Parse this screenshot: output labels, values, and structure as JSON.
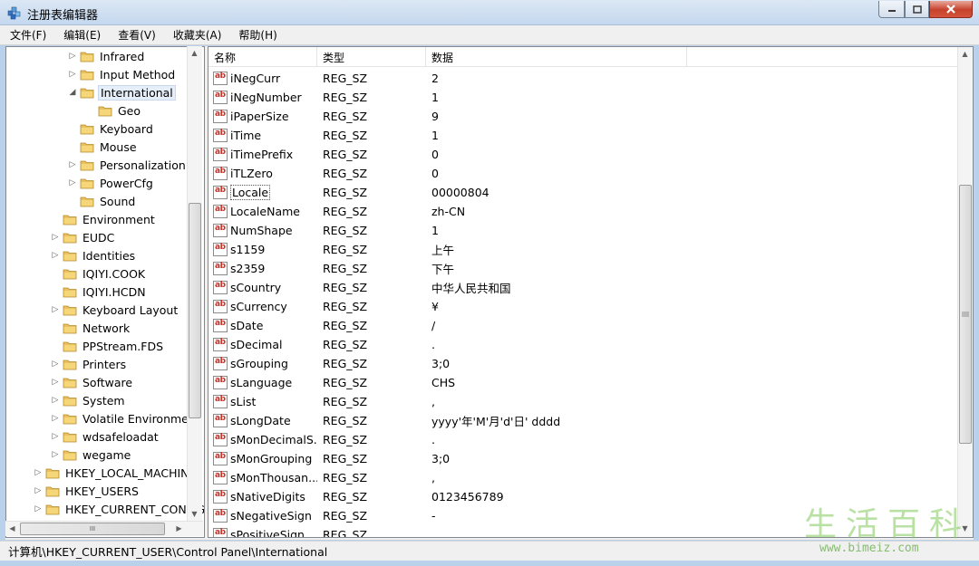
{
  "window": {
    "title": "注册表编辑器",
    "colors": {
      "title_bg": "#c5d8ee",
      "close_btn": "#c6422c",
      "folder": "#e8c160"
    }
  },
  "menu": [
    {
      "label": "文件(F)"
    },
    {
      "label": "编辑(E)"
    },
    {
      "label": "查看(V)"
    },
    {
      "label": "收藏夹(A)"
    },
    {
      "label": "帮助(H)"
    }
  ],
  "tree": [
    {
      "label": "Infrared",
      "expander": "▷"
    },
    {
      "label": "Input Method",
      "expander": "▷"
    },
    {
      "label": "International",
      "expander": "◢",
      "selected": true
    },
    {
      "label": "Geo",
      "expander": ""
    },
    {
      "label": "Keyboard",
      "expander": ""
    },
    {
      "label": "Mouse",
      "expander": ""
    },
    {
      "label": "Personalization",
      "expander": "▷"
    },
    {
      "label": "PowerCfg",
      "expander": "▷"
    },
    {
      "label": "Sound",
      "expander": ""
    },
    {
      "label": "Environment",
      "expander": ""
    },
    {
      "label": "EUDC",
      "expander": "▷"
    },
    {
      "label": "Identities",
      "expander": "▷"
    },
    {
      "label": "IQIYI.COOK",
      "expander": ""
    },
    {
      "label": "IQIYI.HCDN",
      "expander": ""
    },
    {
      "label": "Keyboard Layout",
      "expander": "▷"
    },
    {
      "label": "Network",
      "expander": ""
    },
    {
      "label": "PPStream.FDS",
      "expander": ""
    },
    {
      "label": "Printers",
      "expander": "▷"
    },
    {
      "label": "Software",
      "expander": "▷"
    },
    {
      "label": "System",
      "expander": "▷"
    },
    {
      "label": "Volatile Environment",
      "expander": "▷"
    },
    {
      "label": "wdsafeloadat",
      "expander": "▷"
    },
    {
      "label": "wegame",
      "expander": "▷"
    },
    {
      "label": "HKEY_LOCAL_MACHINE",
      "expander": "▷"
    },
    {
      "label": "HKEY_USERS",
      "expander": "▷"
    },
    {
      "label": "HKEY_CURRENT_CONFIG",
      "expander": "▷"
    }
  ],
  "tree_hscroll_glyph": "III",
  "columns": {
    "name": "名称",
    "type": "类型",
    "data": "数据"
  },
  "rows": [
    {
      "name": "iNegCurr",
      "type": "REG_SZ",
      "data": "2"
    },
    {
      "name": "iNegNumber",
      "type": "REG_SZ",
      "data": "1"
    },
    {
      "name": "iPaperSize",
      "type": "REG_SZ",
      "data": "9"
    },
    {
      "name": "iTime",
      "type": "REG_SZ",
      "data": "1"
    },
    {
      "name": "iTimePrefix",
      "type": "REG_SZ",
      "data": "0"
    },
    {
      "name": "iTLZero",
      "type": "REG_SZ",
      "data": "0"
    },
    {
      "name": "Locale",
      "type": "REG_SZ",
      "data": "00000804",
      "focused": true
    },
    {
      "name": "LocaleName",
      "type": "REG_SZ",
      "data": "zh-CN"
    },
    {
      "name": "NumShape",
      "type": "REG_SZ",
      "data": "1"
    },
    {
      "name": "s1159",
      "type": "REG_SZ",
      "data": "上午"
    },
    {
      "name": "s2359",
      "type": "REG_SZ",
      "data": "下午"
    },
    {
      "name": "sCountry",
      "type": "REG_SZ",
      "data": "中华人民共和国"
    },
    {
      "name": "sCurrency",
      "type": "REG_SZ",
      "data": "¥"
    },
    {
      "name": "sDate",
      "type": "REG_SZ",
      "data": "/"
    },
    {
      "name": "sDecimal",
      "type": "REG_SZ",
      "data": "."
    },
    {
      "name": "sGrouping",
      "type": "REG_SZ",
      "data": "3;0"
    },
    {
      "name": "sLanguage",
      "type": "REG_SZ",
      "data": "CHS"
    },
    {
      "name": "sList",
      "type": "REG_SZ",
      "data": ","
    },
    {
      "name": "sLongDate",
      "type": "REG_SZ",
      "data": "yyyy'年'M'月'd'日' dddd"
    },
    {
      "name": "sMonDecimalS...",
      "type": "REG_SZ",
      "data": "."
    },
    {
      "name": "sMonGrouping",
      "type": "REG_SZ",
      "data": "3;0"
    },
    {
      "name": "sMonThousan...",
      "type": "REG_SZ",
      "data": ","
    },
    {
      "name": "sNativeDigits",
      "type": "REG_SZ",
      "data": "0123456789"
    },
    {
      "name": "sNegativeSign",
      "type": "REG_SZ",
      "data": "-"
    },
    {
      "name": "sPositiveSign",
      "type": "REG_SZ",
      "data": ""
    }
  ],
  "status": {
    "path": "计算机\\HKEY_CURRENT_USER\\Control Panel\\International"
  },
  "watermark": {
    "chars": [
      "生",
      "活",
      "百",
      "科"
    ],
    "url": "www.bimeiz.com"
  }
}
